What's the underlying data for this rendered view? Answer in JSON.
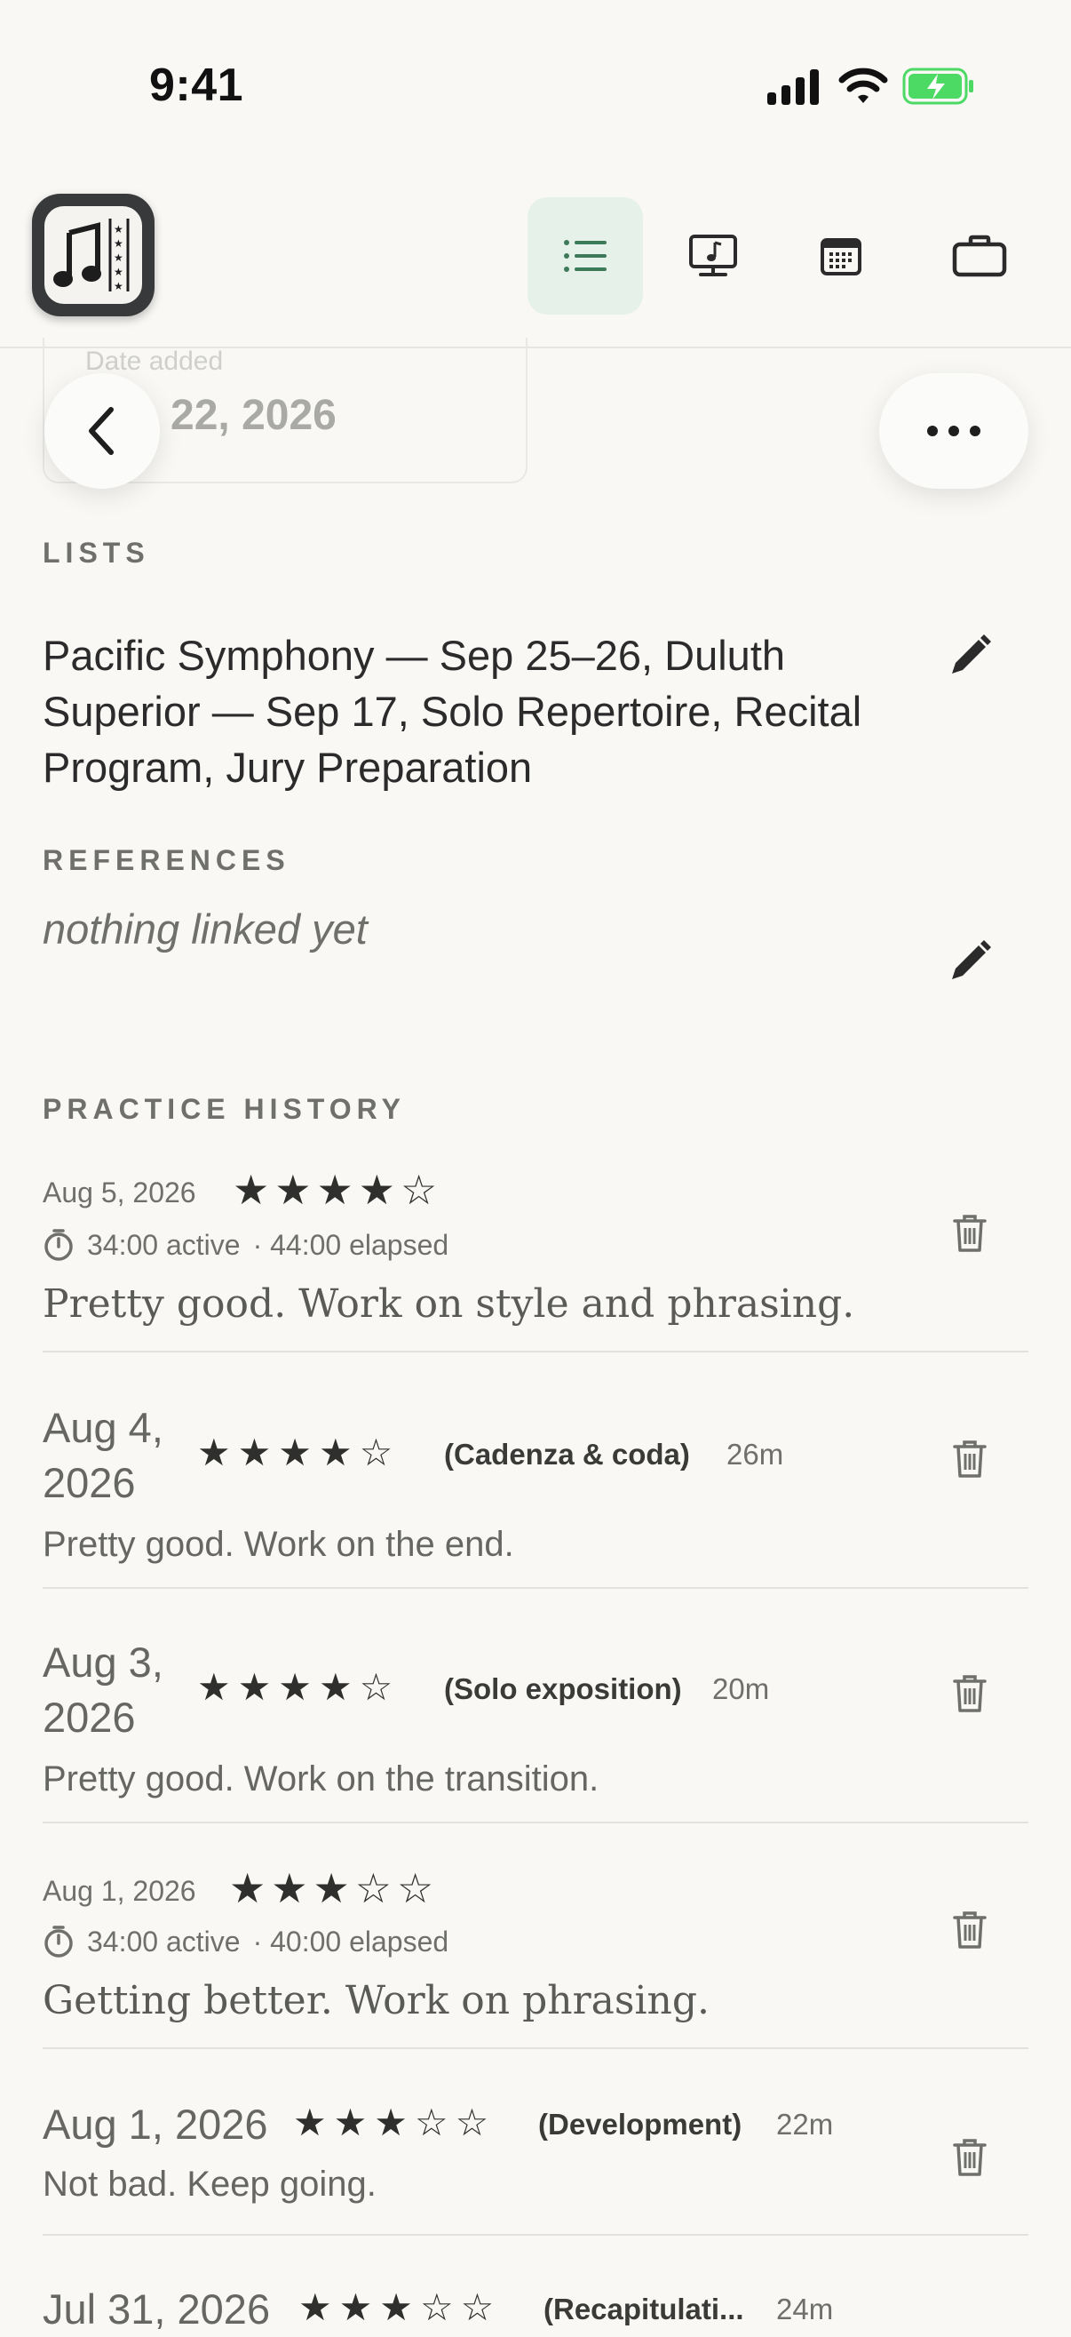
{
  "status_bar": {
    "time": "9:41"
  },
  "toolbar": {
    "tools": [
      {
        "name": "list-view",
        "active": true
      },
      {
        "name": "practice-view",
        "active": false
      },
      {
        "name": "calendar-view",
        "active": false
      },
      {
        "name": "briefcase-view",
        "active": false
      }
    ]
  },
  "header": {
    "date_label": "Date added",
    "date_value": "22, 2026"
  },
  "lists": {
    "heading": "LISTS",
    "value": "Pacific Symphony — Sep 25–26, Duluth Superior — Sep 17, Solo Repertoire, Recital Program, Jury Preparation"
  },
  "references": {
    "heading": "REFERENCES",
    "value": "nothing linked yet"
  },
  "history": {
    "heading": "PRACTICE HISTORY",
    "entries": [
      {
        "date": "Aug 5, 2026",
        "rating": 4,
        "active": "34:00 active",
        "elapsed": "· 44:00 elapsed",
        "note": "Pretty good. Work on style and phrasing."
      },
      {
        "date": "Aug 4, 2026",
        "rating": 4,
        "section": "(Cadenza & coda)",
        "duration": "26m",
        "note": "Pretty good. Work on the end."
      },
      {
        "date": "Aug 3, 2026",
        "rating": 4,
        "section": "(Solo exposition)",
        "duration": "20m",
        "note": "Pretty good. Work on the transition."
      },
      {
        "date": "Aug 1, 2026",
        "rating": 3,
        "active": "34:00 active",
        "elapsed": "· 40:00 elapsed",
        "note": "Getting better. Work on phrasing."
      },
      {
        "date": "Aug 1, 2026",
        "rating": 3,
        "section": "(Development)",
        "duration": "22m",
        "note": "Not bad. Keep going."
      },
      {
        "date": "Jul 31, 2026",
        "rating": 3,
        "section": "(Recapitulati...",
        "duration": "24m"
      }
    ]
  },
  "colors": {
    "accent_bg": "#e6f1ea",
    "accent": "#3d7a5a",
    "background": "#f9f8f5",
    "battery": "#4cd964"
  }
}
